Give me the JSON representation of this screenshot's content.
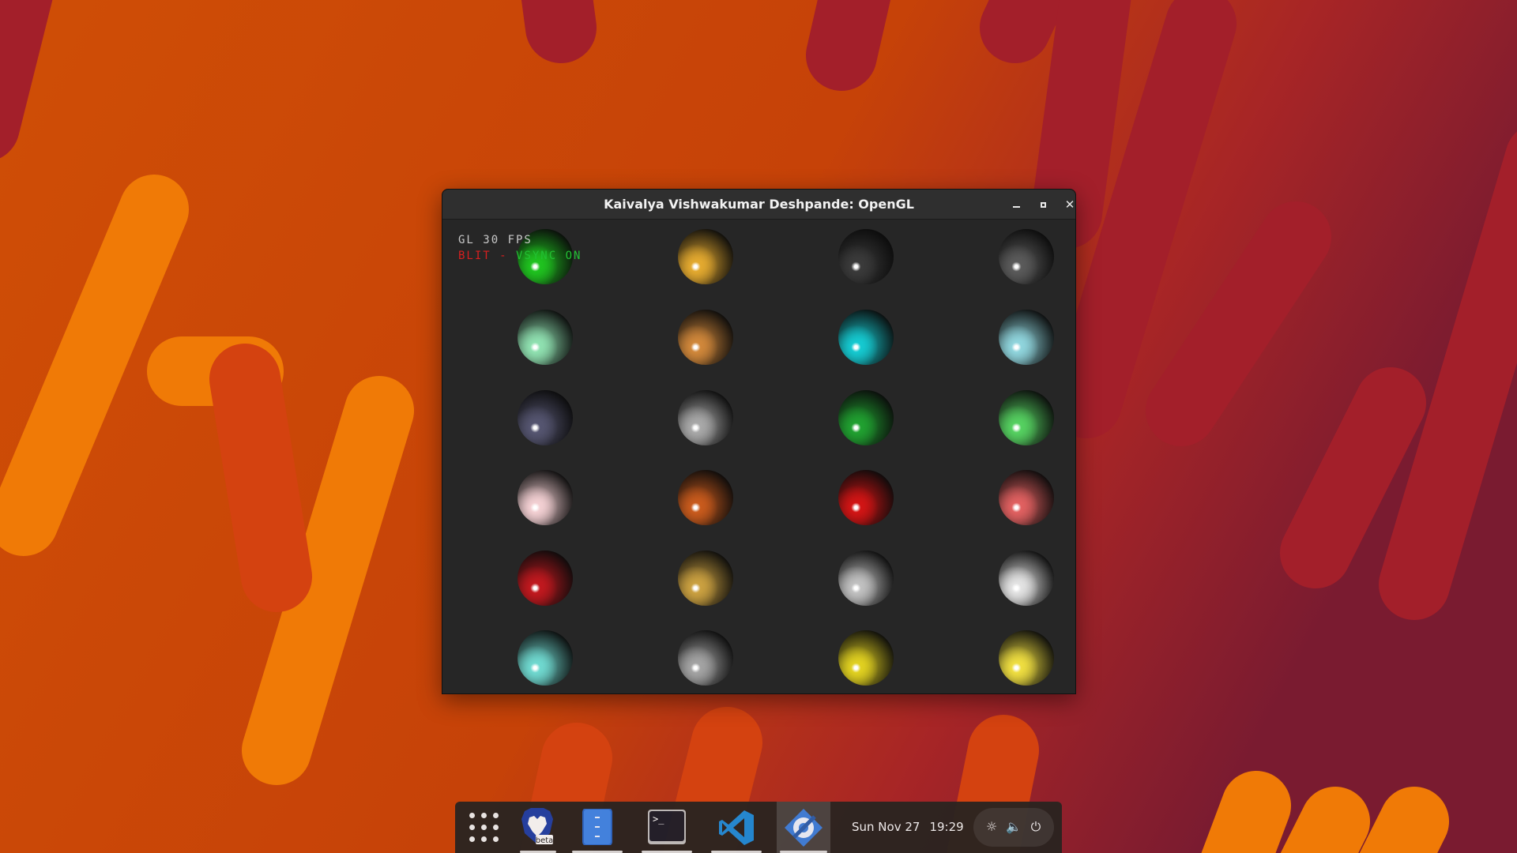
{
  "window": {
    "title": "Kaivalya Vishwakumar Deshpande: OpenGL",
    "controls": {
      "minimize": "minimize",
      "maximize": "maximize",
      "close": "close"
    }
  },
  "hud": {
    "line1": "GL 30 FPS",
    "line2_red": "BLIT",
    "line2_sep": " - ",
    "line2_green": "VSYNC ON"
  },
  "spheres": {
    "rows": 6,
    "columns": 4,
    "colors": [
      [
        "#1fc21f",
        "#e3a92f",
        "#3a3a3a",
        "#5a5a5a"
      ],
      [
        "#8fe0b0",
        "#d0873a",
        "#15c9d0",
        "#8fd4dc"
      ],
      [
        "#555570",
        "#a8a8a8",
        "#20a030",
        "#55d060"
      ],
      [
        "#f2cfd2",
        "#c85a1c",
        "#d11414",
        "#e06060"
      ],
      [
        "#c0181e",
        "#caa040",
        "#c0c0c0",
        "#e2e2e2"
      ],
      [
        "#6fd8cf",
        "#a3a3a3",
        "#e0d020",
        "#eedd40"
      ]
    ]
  },
  "taskbar": {
    "apps": [
      {
        "name": "app-grid",
        "label": "Show Applications"
      },
      {
        "name": "brave-beta",
        "badge": "beta"
      },
      {
        "name": "files"
      },
      {
        "name": "terminal",
        "glyph": ">_"
      },
      {
        "name": "vscode"
      },
      {
        "name": "settings"
      }
    ],
    "date": "Sun Nov 27",
    "time": "19:29"
  },
  "colors": {
    "accent_orange": "#ff7b00",
    "wall_red": "#9b1b2c",
    "window_bg": "#262626"
  }
}
